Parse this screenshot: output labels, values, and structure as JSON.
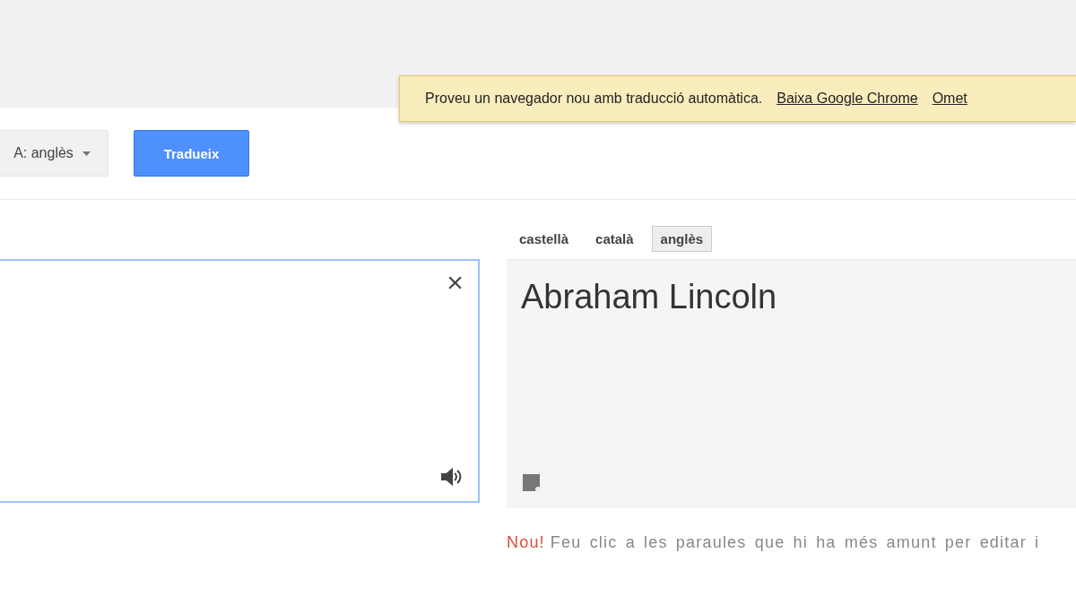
{
  "notice": {
    "message": "Proveu un navegador nou amb traducció automàtica.",
    "links": [
      "Baixa Google Chrome",
      "Omet"
    ]
  },
  "toolbar": {
    "target_language": "A: anglès",
    "translate_button": "Tradueix"
  },
  "target_tabs": [
    {
      "label": "castellà",
      "selected": false
    },
    {
      "label": "català",
      "selected": false
    },
    {
      "label": "anglès",
      "selected": true
    }
  ],
  "source": {
    "clear_icon": "×"
  },
  "output": {
    "text": "Abraham Lincoln"
  },
  "tip": {
    "badge": "Nou!",
    "text": "Feu clic a les paraules que hi ha més amunt per editar i"
  }
}
